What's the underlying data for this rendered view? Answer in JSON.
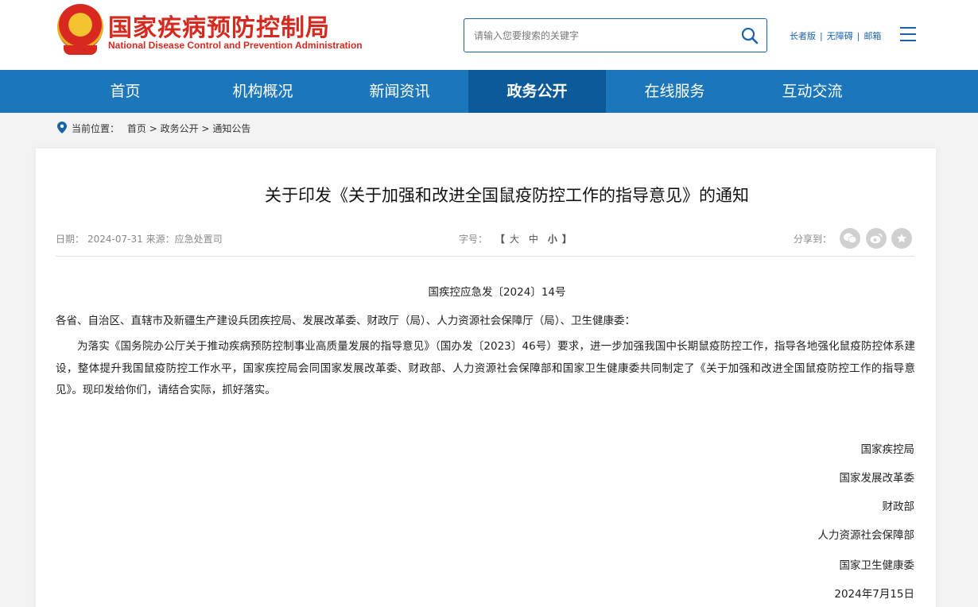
{
  "header": {
    "org_name_cn": "国家疾病预防控制局",
    "org_name_en": "National Disease Control and Prevention Administration",
    "search_placeholder": "请输入您要搜索的关键字",
    "links": [
      "长者版",
      "无障碍",
      "邮箱"
    ]
  },
  "nav": {
    "items": [
      "首页",
      "机构概况",
      "新闻资讯",
      "政务公开",
      "在线服务",
      "互动交流"
    ],
    "active": "政务公开"
  },
  "breadcrumb": {
    "prefix": "当前位置：",
    "items": [
      "首页",
      "政务公开",
      "通知公告"
    ],
    "separator": ">"
  },
  "article": {
    "title": "关于印发《关于加强和改进全国鼠疫防控工作的指导意见》的通知",
    "date_label": "日期：",
    "date": "2024-07-31",
    "source_label": "来源：",
    "source": "应急处置司",
    "fontsize_label": "字号：",
    "fontsize_options": [
      "大",
      "中",
      "小"
    ],
    "share_label": "分享到：",
    "share_icons": [
      "wechat-icon",
      "weibo-icon",
      "favorite-icon"
    ],
    "doc_number": "国疾控应急发〔2024〕14号",
    "salutation": "各省、自治区、直辖市及新疆生产建设兵团疾控局、发展改革委、财政厅（局）、人力资源社会保障厅（局）、卫生健康委：",
    "body": "为落实《国务院办公厅关于推动疾病预防控制事业高质量发展的指导意见》（国办发〔2023〕46号）要求，进一步加强我国中长期鼠疫防控工作，指导各地强化鼠疫防控体系建设，整体提升我国鼠疫防控工作水平，国家疾控局会同国家发展改革委、财政部、人力资源社会保障部和国家卫生健康委共同制定了《关于加强和改进全国鼠疫防控工作的指导意见》。现印发给你们，请结合实际，抓好落实。",
    "signatories": [
      "国家疾控局",
      "国家发展改革委",
      "财政部",
      "人力资源社会保障部",
      "国家卫生健康委"
    ],
    "sign_date": "2024年7月15日"
  },
  "colors": {
    "brand_red": "#d52a20",
    "nav_blue": "#1c76bb",
    "nav_active": "#0d5a9a"
  }
}
